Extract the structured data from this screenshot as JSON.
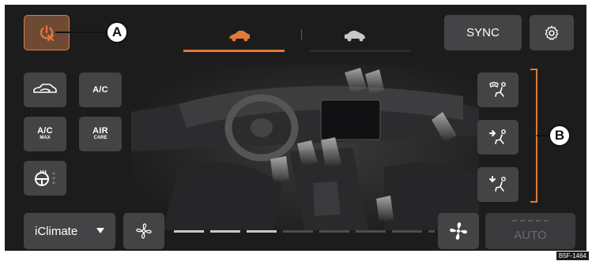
{
  "top_bar": {
    "sync_label": "SYNC",
    "icons": [
      "climate-off-icon",
      "settings-gear-icon"
    ],
    "tabs": [
      {
        "name": "front-car-tab",
        "icon": "car-front-icon",
        "active": true
      },
      {
        "name": "rear-car-tab",
        "icon": "car-rear-icon",
        "active": false
      }
    ]
  },
  "left_panel": {
    "recirculation_icon": "car-recirculation-icon",
    "ac_label": "A/C",
    "ac_max_label": "A/C",
    "ac_max_sub": "MAX",
    "air_care_label": "AIR",
    "air_care_sub": "CARE",
    "heated_wheel_icon": "heated-steering-wheel-icon"
  },
  "right_panel": {
    "air_distribution": [
      "windshield-airflow-icon",
      "upper-body-airflow-icon",
      "footwell-airflow-icon"
    ]
  },
  "bottom_bar": {
    "mode_label": "iClimate",
    "fan_speed_total": 8,
    "fan_speed_level": 3,
    "auto_label": "AUTO"
  },
  "callouts": {
    "a": "A",
    "b": "B"
  },
  "caption": "B5F-1464",
  "colors": {
    "accent": "#e07a3c",
    "button": "#444446",
    "background": "#1c1c1c"
  }
}
